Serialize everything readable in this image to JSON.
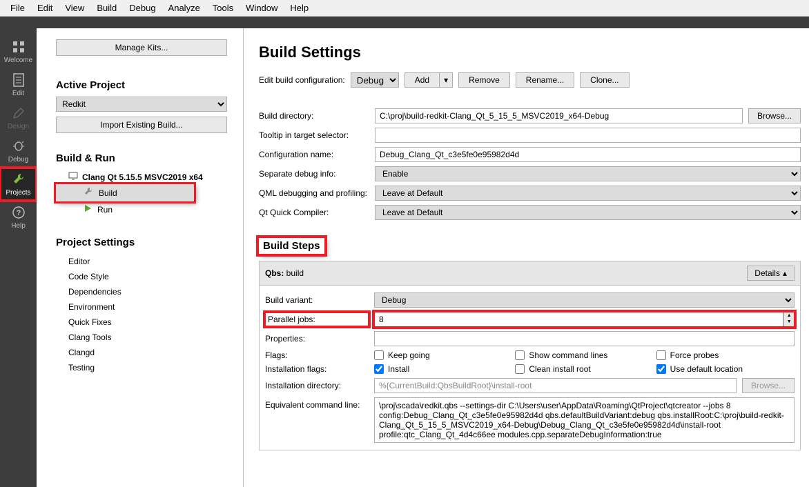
{
  "menu": [
    "File",
    "Edit",
    "View",
    "Build",
    "Debug",
    "Analyze",
    "Tools",
    "Window",
    "Help"
  ],
  "rail": {
    "welcome": "Welcome",
    "edit": "Edit",
    "design": "Design",
    "debug": "Debug",
    "projects": "Projects",
    "help": "Help"
  },
  "side": {
    "manage_kits": "Manage Kits...",
    "active_project": "Active Project",
    "project_name": "Redkit",
    "import_build": "Import Existing Build...",
    "build_run": "Build & Run",
    "kit_name": "Clang Qt 5.15.5 MSVC2019 x64",
    "build": "Build",
    "run": "Run",
    "project_settings": "Project Settings",
    "settings": [
      "Editor",
      "Code Style",
      "Dependencies",
      "Environment",
      "Quick Fixes",
      "Clang Tools",
      "Clangd",
      "Testing"
    ]
  },
  "content": {
    "title": "Build Settings",
    "edit_cfg": "Edit build configuration:",
    "cfg_value": "Debug",
    "add": "Add",
    "remove": "Remove",
    "rename": "Rename...",
    "clone": "Clone...",
    "build_dir_lbl": "Build directory:",
    "build_dir": "C:\\proj\\build-redkit-Clang_Qt_5_15_5_MSVC2019_x64-Debug",
    "browse": "Browse...",
    "tooltip_lbl": "Tooltip in target selector:",
    "tooltip": "",
    "cfg_name_lbl": "Configuration name:",
    "cfg_name": "Debug_Clang_Qt_c3e5fe0e95982d4d",
    "sep_debug_lbl": "Separate debug info:",
    "sep_debug": "Enable",
    "qml_lbl": "QML debugging and profiling:",
    "qml": "Leave at Default",
    "qtquick_lbl": "Qt Quick Compiler:",
    "qtquick": "Leave at Default",
    "build_steps": "Build Steps",
    "qbs_build": "Qbs: build",
    "details": "Details",
    "variant_lbl": "Build variant:",
    "variant": "Debug",
    "parallel_lbl": "Parallel jobs:",
    "parallel": "8",
    "props_lbl": "Properties:",
    "props": "",
    "flags_lbl": "Flags:",
    "keep_going": "Keep going",
    "show_cmd": "Show command lines",
    "force_probes": "Force probes",
    "inst_flags_lbl": "Installation flags:",
    "install": "Install",
    "clean_root": "Clean install root",
    "use_default": "Use default location",
    "inst_dir_lbl": "Installation directory:",
    "inst_dir": "%{CurrentBuild:QbsBuildRoot}\\install-root",
    "eq_cmd_lbl": "Equivalent command line:",
    "eq_cmd": "\\proj\\scada\\redkit.qbs --settings-dir C:\\Users\\user\\AppData\\Roaming\\QtProject\\qtcreator --jobs 8 config:Debug_Clang_Qt_c3e5fe0e95982d4d qbs.defaultBuildVariant:debug qbs.installRoot:C:\\proj\\build-redkit-Clang_Qt_5_15_5_MSVC2019_x64-Debug\\Debug_Clang_Qt_c3e5fe0e95982d4d\\install-root profile:qtc_Clang_Qt_4d4c66ee modules.cpp.separateDebugInformation:true"
  }
}
